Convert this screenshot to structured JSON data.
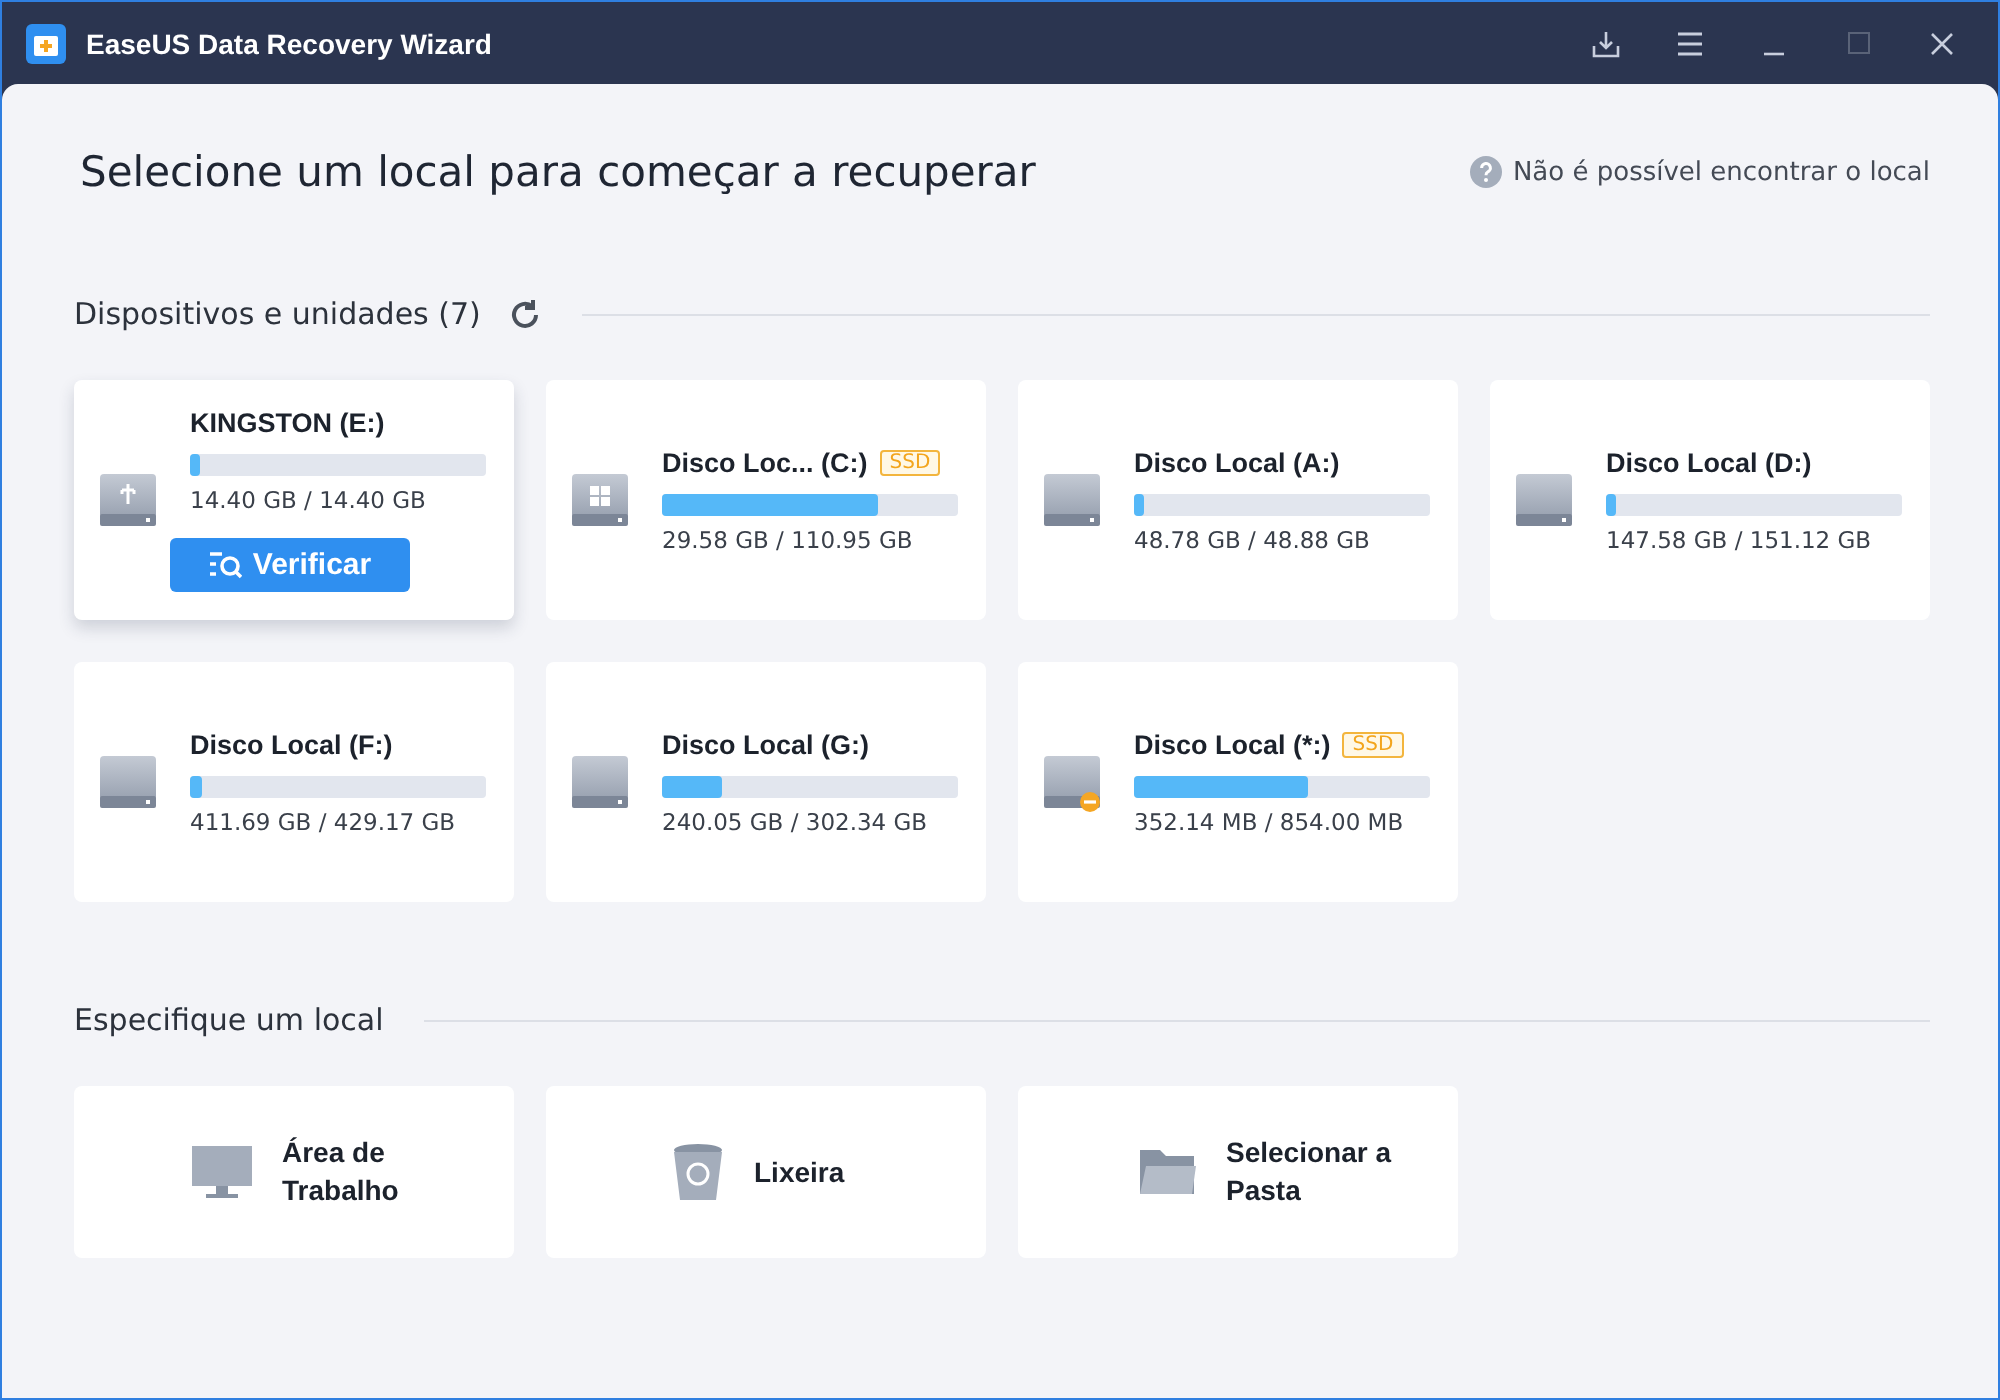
{
  "window": {
    "title": "EaseUS Data Recovery Wizard"
  },
  "heading": "Selecione um local para começar a recuperar",
  "help_link": "Não é possível encontrar o local",
  "devices": {
    "title": "Dispositivos e unidades (7)",
    "drives": [
      {
        "kind": "usb",
        "name": "KINGSTON (E:)",
        "warning": false,
        "level": 0.03,
        "size": "14.40 GB / 14.40 GB",
        "selected": true,
        "action": "Verificar"
      },
      {
        "kind": "system",
        "name": "Disco Loc... (C:)",
        "ssd": "SSD",
        "warning": false,
        "level": 0.73,
        "size": "29.58 GB / 110.95 GB",
        "selected": false
      },
      {
        "kind": "disk",
        "name": "Disco Local (A:)",
        "warning": false,
        "level": 0.03,
        "size": "48.78 GB / 48.88 GB",
        "selected": false
      },
      {
        "kind": "disk",
        "name": "Disco Local (D:)",
        "warning": false,
        "level": 0.03,
        "size": "147.58 GB / 151.12 GB",
        "selected": false
      },
      {
        "kind": "disk",
        "name": "Disco Local (F:)",
        "warning": false,
        "level": 0.04,
        "size": "411.69 GB / 429.17 GB",
        "selected": false
      },
      {
        "kind": "disk",
        "name": "Disco Local (G:)",
        "warning": false,
        "level": 0.2,
        "size": "240.05 GB / 302.34 GB",
        "selected": false
      },
      {
        "kind": "disk",
        "name": "Disco Local (*:)",
        "ssd": "SSD",
        "warning": true,
        "level": 0.59,
        "size": "352.14 MB / 854.00 MB",
        "selected": false
      }
    ]
  },
  "locations": {
    "title": "Especifique um local",
    "items": [
      {
        "kind": "desktop",
        "label": "Área de Trabalho"
      },
      {
        "kind": "trash",
        "label": "Lixeira"
      },
      {
        "kind": "folder",
        "label": "Selecionar a Pasta"
      }
    ]
  }
}
